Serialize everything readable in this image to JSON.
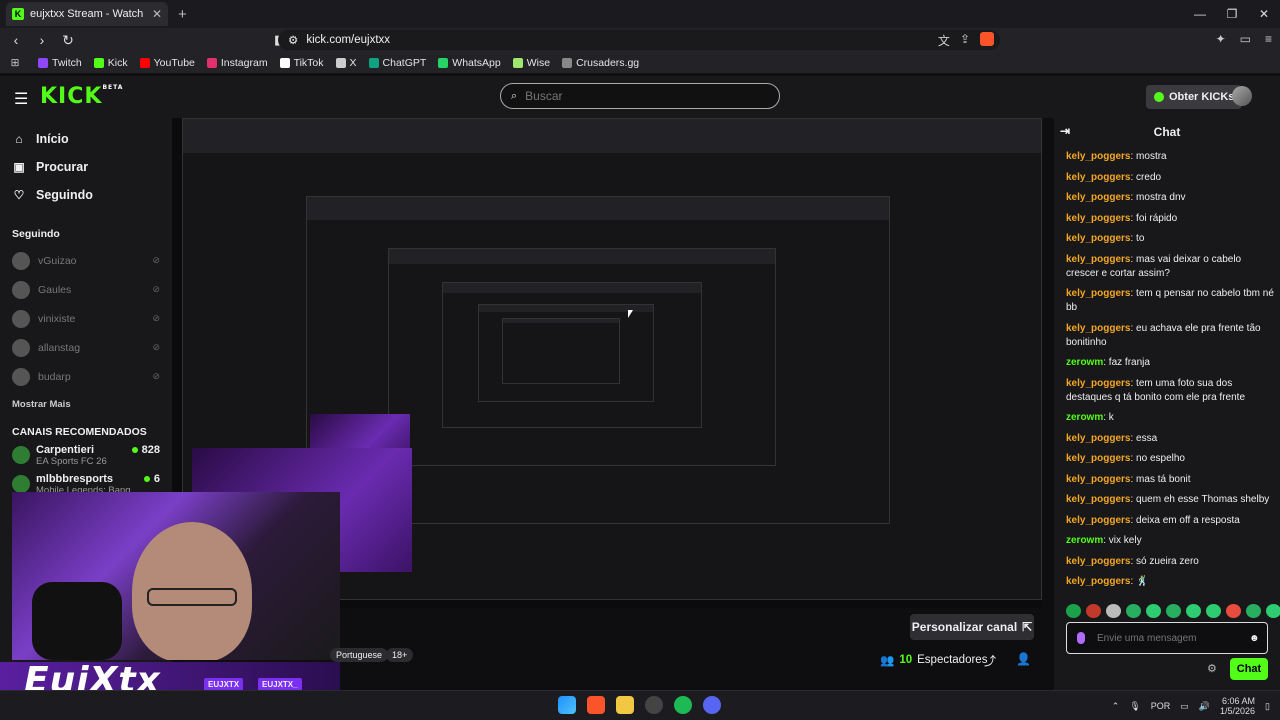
{
  "browser": {
    "tab_title": "eujxtxx Stream - Watch Live on K",
    "tab_close": "✕",
    "new_tab": "+",
    "url": "kick.com/eujxtxx",
    "bookmarks": [
      {
        "label": "Twitch",
        "color": "#9146ff"
      },
      {
        "label": "Kick",
        "color": "#53fc18"
      },
      {
        "label": "YouTube",
        "color": "#ff0000"
      },
      {
        "label": "Instagram",
        "color": "#e1306c"
      },
      {
        "label": "TikTok",
        "color": "#ffffff"
      },
      {
        "label": "X",
        "color": "#cccccc"
      },
      {
        "label": "ChatGPT",
        "color": "#10a37f"
      },
      {
        "label": "WhatsApp",
        "color": "#25d366"
      },
      {
        "label": "Wise",
        "color": "#9fe870"
      },
      {
        "label": "Crusaders.gg",
        "color": "#888888"
      }
    ]
  },
  "header": {
    "logo": "KICK",
    "logo_beta": "BETA",
    "search_placeholder": "Buscar",
    "get_kicks": "Obter KICKs"
  },
  "sidebar": {
    "nav": [
      {
        "label": "Início",
        "icon": "home-icon",
        "glyph": "⌂"
      },
      {
        "label": "Procurar",
        "icon": "browse-icon",
        "glyph": "▣"
      },
      {
        "label": "Seguindo",
        "icon": "heart-icon",
        "glyph": "♡"
      }
    ],
    "following_title": "Seguindo",
    "following": [
      "vGuizao",
      "Gaules",
      "vinixiste",
      "allanstag",
      "budarp"
    ],
    "show_more": "Mostrar Mais",
    "recommended_title": "CANAIS RECOMENDADOS",
    "recommended": [
      {
        "name": "Carpentieri",
        "game": "EA Sports FC 26",
        "viewers": "828"
      },
      {
        "name": "mlbbbresports",
        "game": "Mobile Legends: Bang B...",
        "viewers": "6"
      }
    ]
  },
  "stream": {
    "overlay_name": "EujXtx",
    "social_1": "EUJXTX",
    "social_2": "EUJXTX_",
    "language_tag": "Portuguese",
    "mature_tag": "18+",
    "customize_label": "Personalizar canal",
    "viewers_count": "10",
    "viewers_label": "Espectadores"
  },
  "chat": {
    "title": "Chat",
    "messages": [
      {
        "user": "kely_poggers",
        "color": "#f5a623",
        "text": "mostra"
      },
      {
        "user": "kely_poggers",
        "color": "#f5a623",
        "text": "credo"
      },
      {
        "user": "kely_poggers",
        "color": "#f5a623",
        "text": "mostra dnv"
      },
      {
        "user": "kely_poggers",
        "color": "#f5a623",
        "text": "foi rápido"
      },
      {
        "user": "kely_poggers",
        "color": "#f5a623",
        "text": "to"
      },
      {
        "user": "kely_poggers",
        "color": "#f5a623",
        "text": "mas vai deixar o cabelo crescer e cortar assim?"
      },
      {
        "user": "kely_poggers",
        "color": "#f5a623",
        "text": "tem q pensar no cabelo tbm né bb"
      },
      {
        "user": "kely_poggers",
        "color": "#f5a623",
        "text": "eu achava ele pra frente tão bonitinho"
      },
      {
        "user": "zerowm",
        "color": "#53fc18",
        "text": "faz franja"
      },
      {
        "user": "kely_poggers",
        "color": "#f5a623",
        "text": "tem uma foto sua dos destaques q tá bonito com ele pra frente"
      },
      {
        "user": "zerowm",
        "color": "#53fc18",
        "text": "k"
      },
      {
        "user": "kely_poggers",
        "color": "#f5a623",
        "text": "essa"
      },
      {
        "user": "kely_poggers",
        "color": "#f5a623",
        "text": "no espelho"
      },
      {
        "user": "kely_poggers",
        "color": "#f5a623",
        "text": "mas tá bonit"
      },
      {
        "user": "kely_poggers",
        "color": "#f5a623",
        "text": "quem eh esse Thomas shelby"
      },
      {
        "user": "kely_poggers",
        "color": "#f5a623",
        "text": "deixa em off a resposta"
      },
      {
        "user": "zerowm",
        "color": "#53fc18",
        "text": "vix kely"
      },
      {
        "user": "kely_poggers",
        "color": "#f5a623",
        "text": "só zueira zero"
      },
      {
        "user": "kely_poggers",
        "color": "#f5a623",
        "text": "🕺"
      }
    ],
    "input_placeholder": "Envie uma mensagem",
    "send_label": "Chat"
  },
  "taskbar": {
    "language": "POR",
    "time": "6:06 AM",
    "date": "1/5/2026"
  }
}
